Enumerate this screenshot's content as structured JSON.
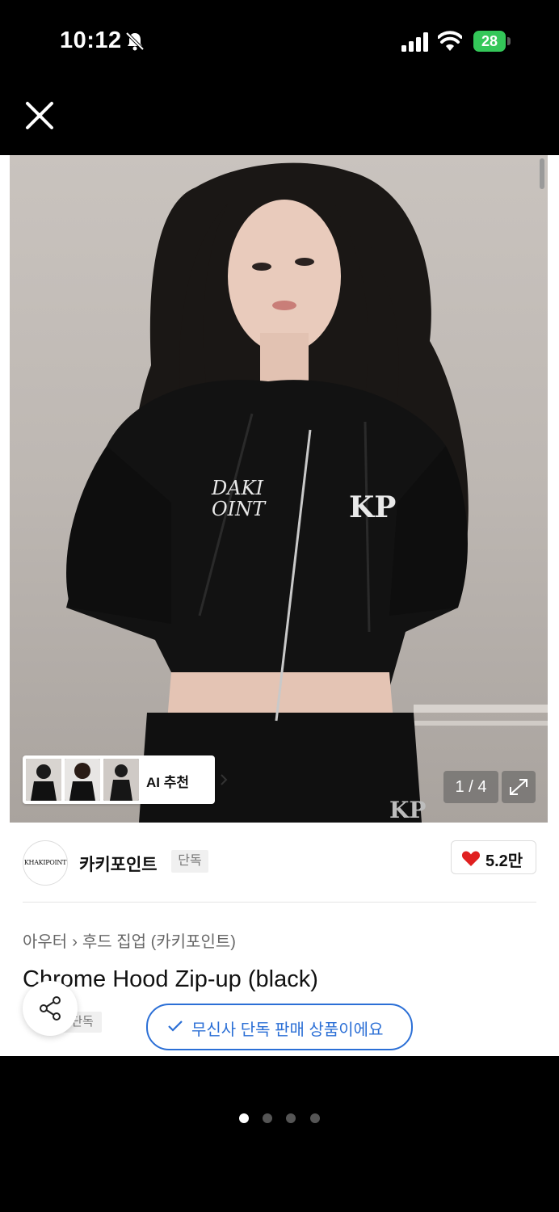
{
  "status_bar": {
    "time": "10:12",
    "battery": "28"
  },
  "gallery": {
    "counter": "1 / 4",
    "ai_label": "AI 추천"
  },
  "brand": {
    "logo_text": "KHAKIPOINT",
    "name": "카키포인트",
    "badge": "단독",
    "likes": "5.2만"
  },
  "breadcrumb": {
    "cat1": "아우터",
    "cat2": "후드 집업 (카키포인트)"
  },
  "product": {
    "title": "Chrome Hood Zip-up (black)",
    "badge": "단독",
    "notice": "무신사 단독 판매 상품이에요"
  },
  "pager": {
    "count": 4,
    "active_index": 0
  },
  "colors": {
    "accent_blue": "#2b6fd6",
    "heart_red": "#e02020",
    "battery_green": "#34c759"
  }
}
